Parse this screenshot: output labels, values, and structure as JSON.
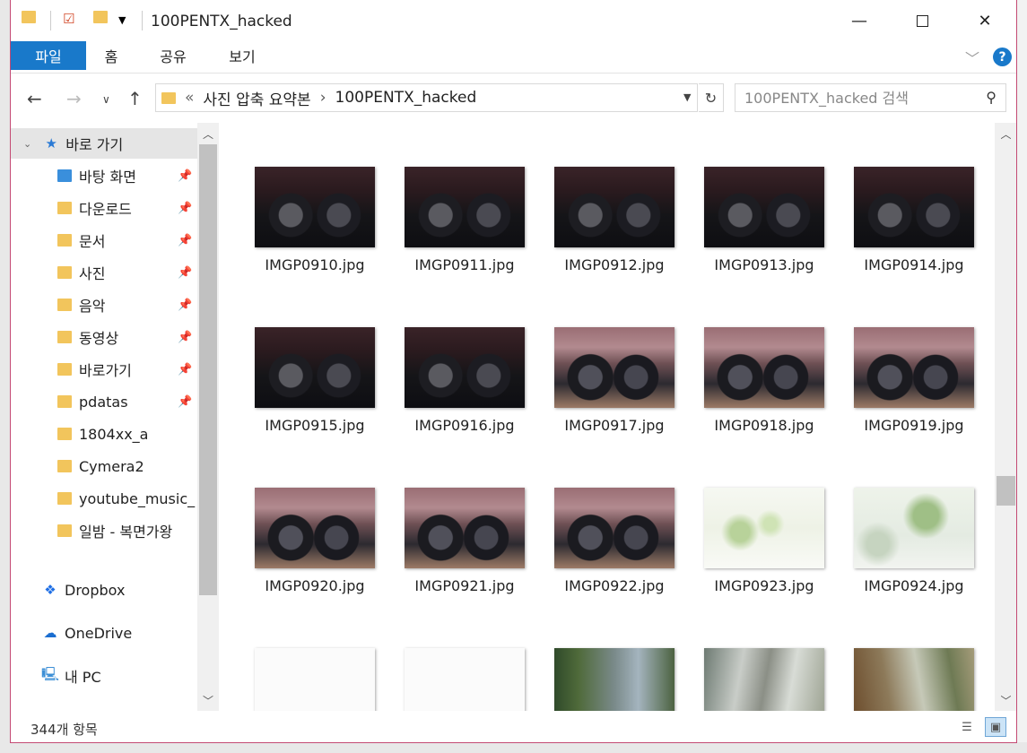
{
  "window": {
    "title": "100PENTX_hacked",
    "minimize_icon": "minimize-icon",
    "maximize_icon": "maximize-icon",
    "close_icon": "close-icon"
  },
  "ribbon": {
    "tabs": [
      {
        "label": "파일",
        "active": true
      },
      {
        "label": "홈"
      },
      {
        "label": "공유"
      },
      {
        "label": "보기"
      }
    ],
    "help_label": "?"
  },
  "address": {
    "prefix": "«",
    "crumbs": [
      "사진 압축 요약본",
      "100PENTX_hacked"
    ],
    "separator": "›",
    "search_placeholder": "100PENTX_hacked 검색"
  },
  "sidebar": {
    "quick_access_label": "바로 가기",
    "items": [
      {
        "label": "바탕 화면",
        "icon": "desktop-folder-icon",
        "pinned": true
      },
      {
        "label": "다운로드",
        "icon": "downloads-folder-icon",
        "pinned": true
      },
      {
        "label": "문서",
        "icon": "documents-folder-icon",
        "pinned": true
      },
      {
        "label": "사진",
        "icon": "pictures-folder-icon",
        "pinned": true
      },
      {
        "label": "음악",
        "icon": "music-folder-icon",
        "pinned": true
      },
      {
        "label": "동영상",
        "icon": "videos-folder-icon",
        "pinned": true
      },
      {
        "label": "바로가기",
        "icon": "folder-icon",
        "pinned": true
      },
      {
        "label": "pdatas",
        "icon": "folder-icon",
        "pinned": true
      },
      {
        "label": "1804xx_a",
        "icon": "synced-folder-icon",
        "pinned": false
      },
      {
        "label": "Cymera2",
        "icon": "folder-icon",
        "pinned": false
      },
      {
        "label": "youtube_music_",
        "icon": "folder-icon",
        "pinned": false
      },
      {
        "label": "일밤 - 복면가왕",
        "icon": "folder-icon",
        "pinned": false
      }
    ],
    "dropbox_label": "Dropbox",
    "onedrive_label": "OneDrive",
    "pc_label": "내 PC"
  },
  "files": [
    {
      "name": "IMGP0910.jpg",
      "style": "dark"
    },
    {
      "name": "IMGP0911.jpg",
      "style": "dark"
    },
    {
      "name": "IMGP0912.jpg",
      "style": "dark"
    },
    {
      "name": "IMGP0913.jpg",
      "style": "dark"
    },
    {
      "name": "IMGP0914.jpg",
      "style": "dark"
    },
    {
      "name": "IMGP0915.jpg",
      "style": "dark"
    },
    {
      "name": "IMGP0916.jpg",
      "style": "dark"
    },
    {
      "name": "IMGP0917.jpg",
      "style": "pink"
    },
    {
      "name": "IMGP0918.jpg",
      "style": "pink"
    },
    {
      "name": "IMGP0919.jpg",
      "style": "pink"
    },
    {
      "name": "IMGP0920.jpg",
      "style": "pink"
    },
    {
      "name": "IMGP0921.jpg",
      "style": "pink"
    },
    {
      "name": "IMGP0922.jpg",
      "style": "pink"
    },
    {
      "name": "IMGP0923.jpg",
      "style": "light-tree"
    },
    {
      "name": "IMGP0924.jpg",
      "style": "light-tree2"
    },
    {
      "name": "",
      "style": "white"
    },
    {
      "name": "",
      "style": "white"
    },
    {
      "name": "",
      "style": "street"
    },
    {
      "name": "",
      "style": "blur1"
    },
    {
      "name": "",
      "style": "blur2"
    }
  ],
  "status": {
    "item_count": "344개 항목"
  },
  "colors": {
    "accent": "#1979ca",
    "window_border": "#c44a74",
    "folder": "#f2c55c"
  }
}
